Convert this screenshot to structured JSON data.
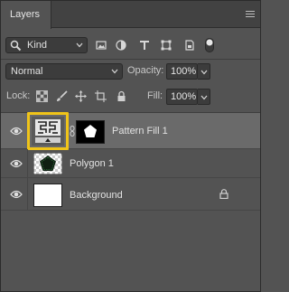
{
  "panel": {
    "tab_label": "Layers",
    "menu_icon": "hamburger-menu-icon"
  },
  "filter": {
    "kind_label": "Kind",
    "icons": [
      "pixel-filter-icon",
      "adjustment-filter-icon",
      "type-filter-icon",
      "shape-filter-icon",
      "smart-object-filter-icon",
      "filter-toggle-icon"
    ]
  },
  "blend": {
    "mode": "Normal",
    "opacity_label": "Opacity:",
    "opacity_value": "100%"
  },
  "lock": {
    "label": "Lock:",
    "icons": [
      "lock-transparent-icon",
      "lock-image-icon",
      "lock-position-icon",
      "lock-artboard-icon",
      "lock-all-icon"
    ],
    "fill_label": "Fill:",
    "fill_value": "100%"
  },
  "layers": [
    {
      "name": "Pattern Fill 1",
      "selected": true,
      "visible": true
    },
    {
      "name": "Polygon 1",
      "selected": false,
      "visible": true
    },
    {
      "name": "Background",
      "selected": false,
      "visible": true,
      "locked": true
    }
  ],
  "colors": {
    "highlight": "#f0c419",
    "panel_bg": "#535353",
    "selected_row": "#6a6a6a"
  }
}
